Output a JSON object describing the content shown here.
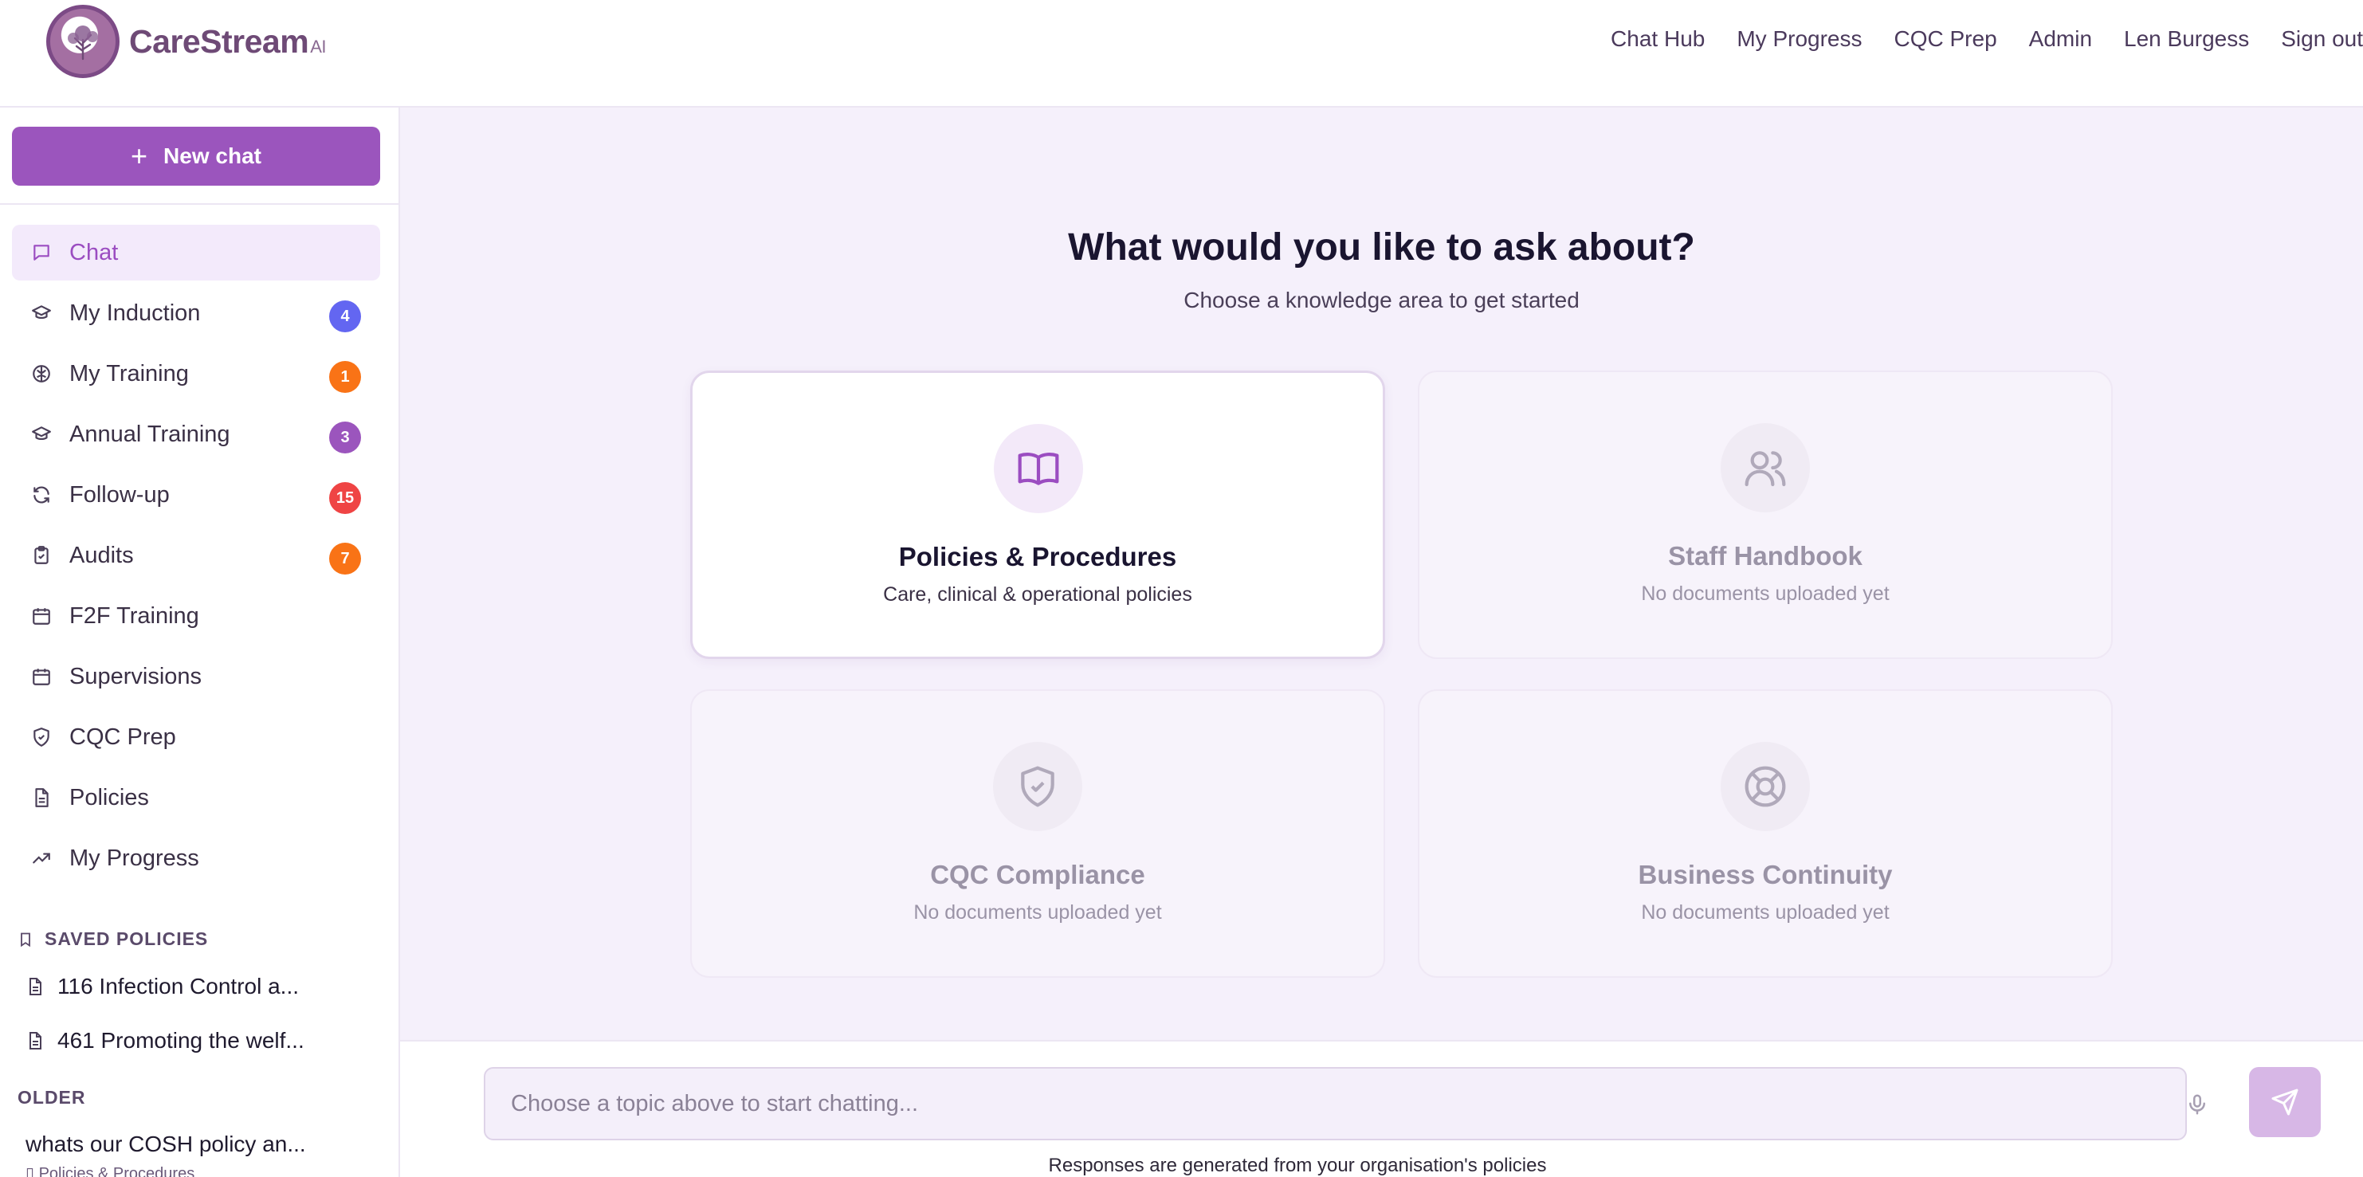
{
  "brand": {
    "name": "CareStream",
    "suffix": "AI"
  },
  "topnav": [
    "Chat Hub",
    "My Progress",
    "CQC Prep",
    "Admin",
    "Len Burgess",
    "Sign out"
  ],
  "sidebar": {
    "new_chat_label": "New chat",
    "items": [
      {
        "label": "Chat",
        "icon": "chat-bubble-icon",
        "active": true
      },
      {
        "label": "My Induction",
        "icon": "graduation-cap-icon",
        "badge": "4",
        "badge_color": "#6366f1"
      },
      {
        "label": "My Training",
        "icon": "brain-icon",
        "badge": "1",
        "badge_color": "#f97316"
      },
      {
        "label": "Annual Training",
        "icon": "graduation-cap-icon",
        "badge": "3",
        "badge_color": "#9b55bd"
      },
      {
        "label": "Follow-up",
        "icon": "refresh-icon",
        "badge": "15",
        "badge_color": "#ef4444"
      },
      {
        "label": "Audits",
        "icon": "clipboard-check-icon",
        "badge": "7",
        "badge_color": "#f97316"
      },
      {
        "label": "F2F Training",
        "icon": "calendar-icon"
      },
      {
        "label": "Supervisions",
        "icon": "calendar-icon"
      },
      {
        "label": "CQC Prep",
        "icon": "shield-check-icon"
      },
      {
        "label": "Policies",
        "icon": "document-icon"
      },
      {
        "label": "My Progress",
        "icon": "trending-up-icon"
      }
    ],
    "saved_label": "SAVED POLICIES",
    "saved": [
      "116 Infection Control a...",
      "461 Promoting the welf..."
    ],
    "older_label": "OLDER",
    "older": [
      {
        "title": "whats our COSH policy an...",
        "sub": "Policies & Procedures"
      }
    ]
  },
  "main": {
    "headline": "What would you like to ask about?",
    "subline": "Choose a knowledge area to get started",
    "cards": [
      {
        "title": "Policies & Procedures",
        "desc": "Care, clinical & operational policies",
        "icon": "open-book-icon",
        "enabled": true
      },
      {
        "title": "Staff Handbook",
        "desc": "No documents uploaded yet",
        "icon": "users-icon",
        "enabled": false
      },
      {
        "title": "CQC Compliance",
        "desc": "No documents uploaded yet",
        "icon": "shield-check-icon",
        "enabled": false
      },
      {
        "title": "Business Continuity",
        "desc": "No documents uploaded yet",
        "icon": "life-buoy-icon",
        "enabled": false
      }
    ]
  },
  "composer": {
    "placeholder": "Choose a topic above to start chatting...",
    "disclaimer": "Responses are generated from your organisation's policies"
  },
  "colors": {
    "accent": "#9b55bd",
    "background": "#f5f0fb"
  }
}
